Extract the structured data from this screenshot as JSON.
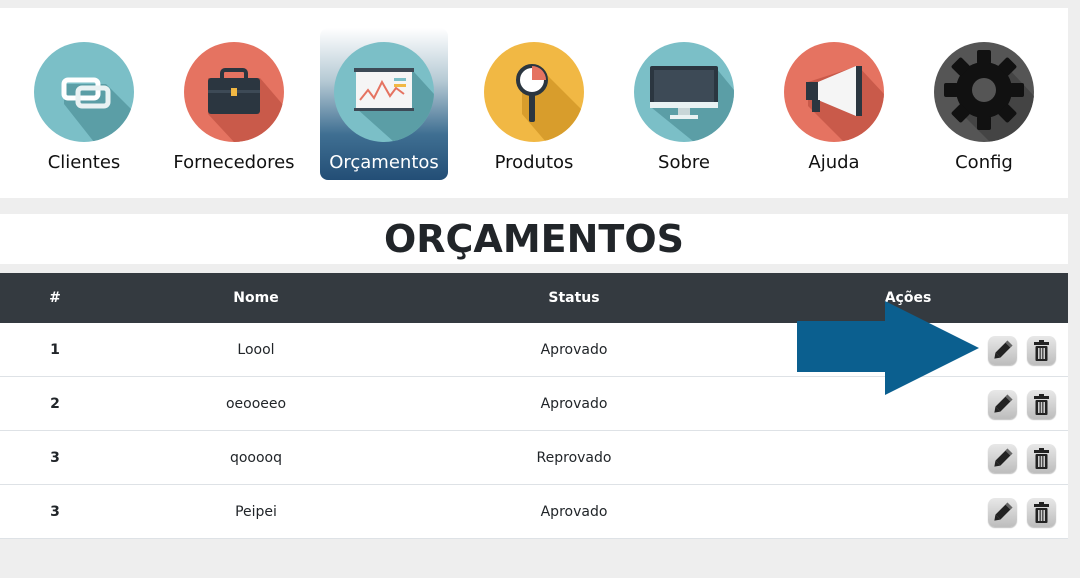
{
  "nav": {
    "items": [
      {
        "label": "Clientes",
        "icon": "link-icon",
        "color": "#7bbfc7"
      },
      {
        "label": "Fornecedores",
        "icon": "briefcase-icon",
        "color": "#e57361"
      },
      {
        "label": "Orçamentos",
        "icon": "presentation-board-icon",
        "color": "#7bbfc7",
        "active": true
      },
      {
        "label": "Produtos",
        "icon": "magnifier-icon",
        "color": "#f1b844"
      },
      {
        "label": "Sobre",
        "icon": "monitor-icon",
        "color": "#7bbfc7"
      },
      {
        "label": "Ajuda",
        "icon": "megaphone-icon",
        "color": "#e57361"
      },
      {
        "label": "Config",
        "icon": "gear-icon",
        "color": "#555555"
      }
    ]
  },
  "page": {
    "title": "ORÇAMENTOS"
  },
  "table": {
    "headers": {
      "num": "#",
      "name": "Nome",
      "status": "Status",
      "actions": "Ações"
    },
    "rows": [
      {
        "num": "1",
        "name": "Loool",
        "status": "Aprovado"
      },
      {
        "num": "2",
        "name": "oeooeeo",
        "status": "Aprovado"
      },
      {
        "num": "3",
        "name": "qooooq",
        "status": "Reprovado"
      },
      {
        "num": "3",
        "name": "Peipei",
        "status": "Aprovado"
      }
    ],
    "actions": {
      "edit_icon": "pencil-icon",
      "delete_icon": "trash-icon"
    }
  },
  "annotation": {
    "arrow_color": "#0b5f8f",
    "target": "edit-button row 1"
  }
}
